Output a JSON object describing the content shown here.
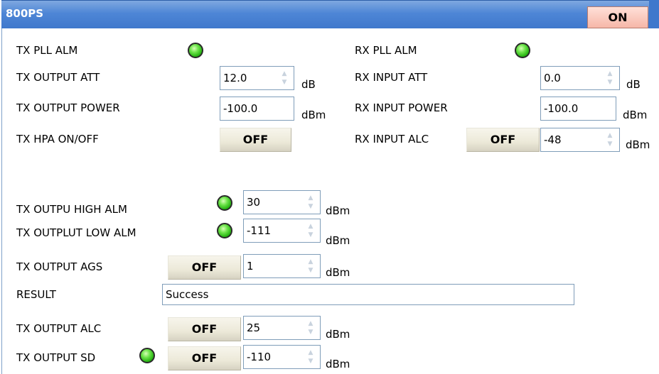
{
  "title": "800PS",
  "on_button": "ON",
  "left": {
    "tx_pll_alm": "TX PLL ALM",
    "tx_output_att": "TX OUTPUT ATT",
    "tx_output_att_value": "12.0",
    "tx_output_att_unit": "dB",
    "tx_output_power": "TX OUTPUT POWER",
    "tx_output_power_value": "-100.0",
    "tx_output_power_unit": "dBm",
    "tx_hpa": "TX HPA ON/OFF",
    "tx_hpa_btn": "OFF"
  },
  "right": {
    "rx_pll_alm": "RX PLL ALM",
    "rx_input_att": "RX INPUT ATT",
    "rx_input_att_value": "0.0",
    "rx_input_att_unit": "dB",
    "rx_input_power": "RX INPUT POWER",
    "rx_input_power_value": "-100.0",
    "rx_input_power_unit": "dBm",
    "rx_input_alc": "RX INPUT ALC",
    "rx_input_alc_btn": "OFF",
    "rx_input_alc_value": "-48",
    "rx_input_alc_unit": "dBm"
  },
  "lower": {
    "high_alm": "TX OUTPU HIGH ALM",
    "high_alm_value": "30",
    "high_alm_unit": "dBm",
    "low_alm": "TX OUTPLUT LOW ALM",
    "low_alm_value": "-111",
    "low_alm_unit": "dBm",
    "ags": "TX OUTPUT AGS",
    "ags_btn": "OFF",
    "ags_value": "1",
    "ags_unit": "dBm",
    "result": "RESULT",
    "result_value": "Success",
    "alc": "TX OUTPUT ALC",
    "alc_btn": "OFF",
    "alc_value": "25",
    "alc_unit": "dBm",
    "sd": "TX OUTPUT SD",
    "sd_btn": "OFF",
    "sd_value": "-110",
    "sd_unit": "dBm"
  },
  "colors": {
    "titlebar": "#4e86d6",
    "on_button": "#f6b7a8",
    "led": "#1fae0c"
  }
}
